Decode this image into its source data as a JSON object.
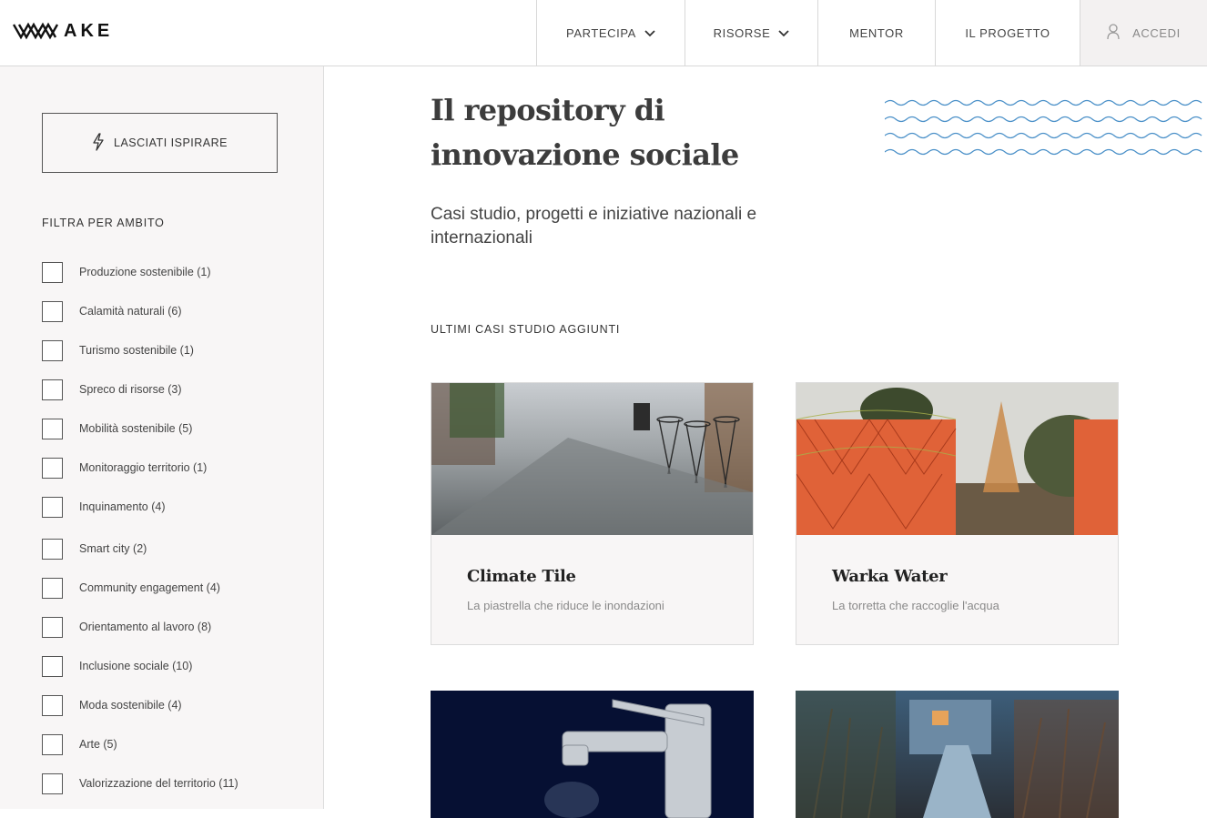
{
  "header": {
    "logo_text": "AKE",
    "nav": [
      {
        "label": "PARTECIPA",
        "has_dropdown": true
      },
      {
        "label": "RISORSE",
        "has_dropdown": true
      },
      {
        "label": "MENTOR",
        "has_dropdown": false
      },
      {
        "label": "IL PROGETTO",
        "has_dropdown": false
      },
      {
        "label": "ACCEDI",
        "icon": "user-icon"
      }
    ]
  },
  "sidebar": {
    "inspire_button": {
      "label": "LASCIATI ISPIRARE",
      "icon": "bolt-icon"
    },
    "filter_title": "FILTRA PER AMBITO",
    "filters": [
      {
        "label": "Produzione sostenibile (1)"
      },
      {
        "label": "Calamità naturali (6)"
      },
      {
        "label": "Turismo sostenibile (1)"
      },
      {
        "label": "Spreco di risorse (3)"
      },
      {
        "label": "Mobilità sostenibile (5)"
      },
      {
        "label": "Monitoraggio territorio (1)"
      },
      {
        "label": "Inquinamento (4)"
      },
      {
        "label": "Smart city (2)"
      },
      {
        "label": "Community engagement (4)"
      },
      {
        "label": "Orientamento al lavoro (8)"
      },
      {
        "label": "Inclusione sociale (10)"
      },
      {
        "label": "Moda sostenibile (4)"
      },
      {
        "label": "Arte (5)"
      },
      {
        "label": "Valorizzazione del territorio (11)"
      }
    ]
  },
  "main": {
    "title_line1": "Il repository di",
    "title_line2": "innovazione sociale",
    "subtitle": "Casi studio, progetti e iniziative nazionali e internazionali",
    "section_label": "ULTIMI CASI STUDIO AGGIUNTI",
    "cards": [
      {
        "title": "Climate Tile",
        "description": "La piastrella che riduce le inondazioni"
      },
      {
        "title": "Warka Water",
        "description": "La torretta che raccoglie l'acqua"
      }
    ]
  },
  "colors": {
    "accent_wave": "#4a90c8",
    "sidebar_bg": "#f8f6f6",
    "border": "#dcdcdc"
  }
}
